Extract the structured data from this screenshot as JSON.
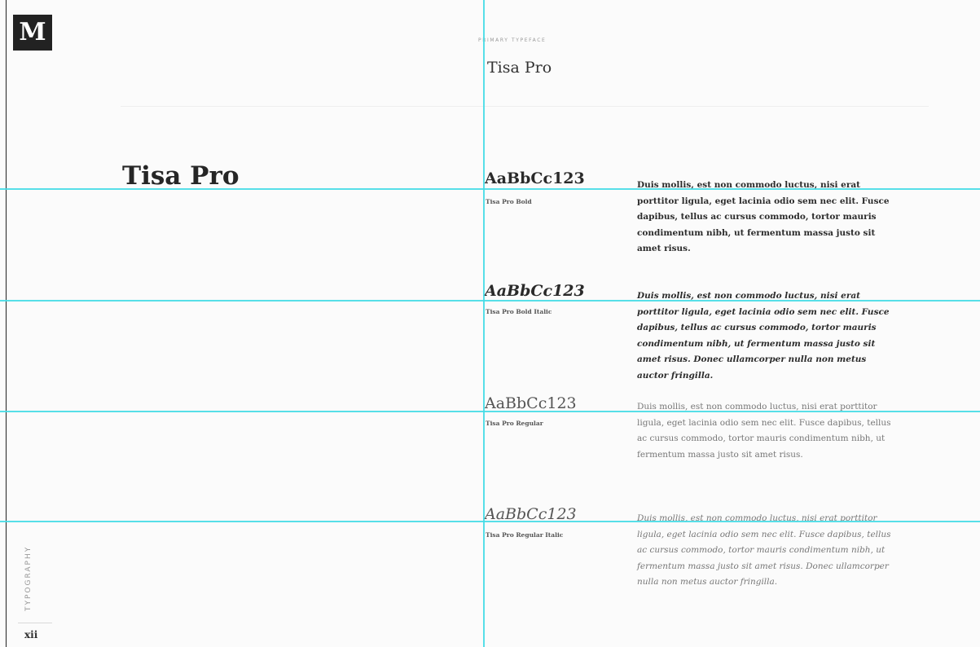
{
  "logo": {
    "letter": "M"
  },
  "header": {
    "eyebrow": "PRIMARY TYPEFACE",
    "title": "Tisa Pro"
  },
  "main_title": "Tisa Pro",
  "specimens": [
    {
      "sample": "AaBbCc123",
      "style_name": "Tisa Pro Bold",
      "paragraph": "Duis mollis, est non commodo luctus, nisi erat porttitor ligula, eget lacinia odio sem nec elit. Fusce dapibus, tellus ac cursus commodo, tortor mauris condimentum nibh, ut fermentum massa justo sit amet risus."
    },
    {
      "sample": "AaBbCc123",
      "style_name": "Tisa Pro Bold Italic",
      "paragraph": "Duis mollis, est non commodo luctus, nisi erat porttitor ligula, eget lacinia odio sem nec elit. Fusce dapibus, tellus ac cursus commodo, tortor mauris condimentum nibh, ut fermentum massa justo sit amet risus. Donec ullamcorper nulla non metus auctor fringilla."
    },
    {
      "sample": "AaBbCc123",
      "style_name": "Tisa Pro Regular",
      "paragraph": "Duis mollis, est non commodo luctus, nisi erat porttitor ligula, eget lacinia odio sem nec elit. Fusce dapibus, tellus ac cursus commodo, tortor mauris condimentum nibh, ut fermentum massa justo sit amet risus."
    },
    {
      "sample": "AaBbCc123",
      "style_name": "Tisa Pro Regular Italic",
      "paragraph": "Duis mollis, est non commodo luctus, nisi erat porttitor ligula, eget lacinia odio sem nec elit. Fusce dapibus, tellus ac cursus commodo, tortor mauris condimentum nibh, ut fermentum massa justo sit amet risus. Donec ullamcorper nulla non metus auctor fringilla."
    }
  ],
  "sidebar": {
    "section_label": "TYPOGRAPHY",
    "page_number": "xii"
  },
  "colors": {
    "guide": "#45dbe6",
    "logo_bg": "#222222",
    "page_bg": "#fbfbfb"
  }
}
